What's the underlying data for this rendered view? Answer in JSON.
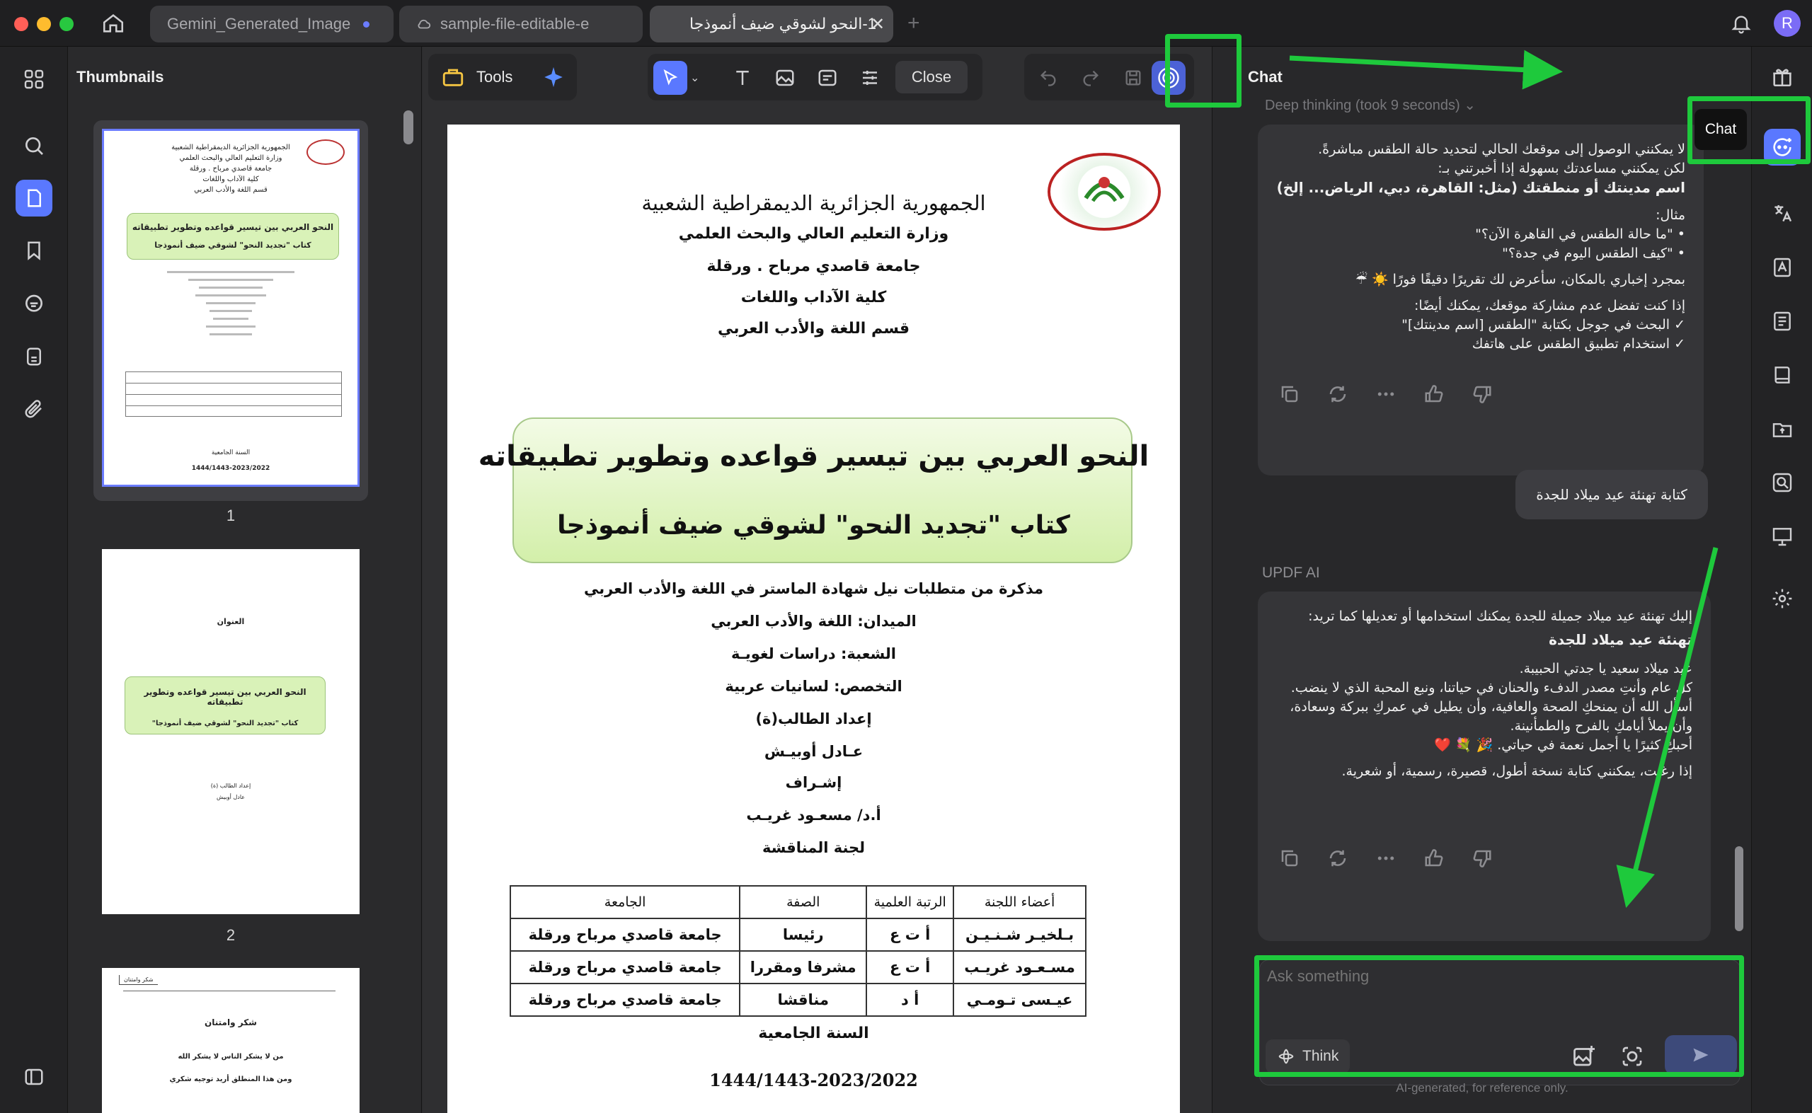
{
  "tabs": [
    {
      "label": "Gemini_Generated_Image",
      "unsaved": true
    },
    {
      "label": "sample-file-editable-e"
    },
    {
      "label": "1-النحو لشوقي ضيف أنموذجا"
    }
  ],
  "avatar_letter": "R",
  "thumbnails": {
    "title": "Thumbnails",
    "pages": [
      {
        "number": "1",
        "lines": [
          "الجمهورية الجزائرية الديمقراطية الشعبية",
          "وزارة التعليم العالي والبحث العلمي",
          "جامعة قاصدي مرباح . ورقلة",
          "كلية الآداب واللغات",
          "قسم اللغة والأدب العربي"
        ],
        "box_title": "النحو العربي بين تيسير قواعده وتطوير تطبيقاته",
        "box_sub": "كتاب \"تجديد النحو\" لشوقي ضيف أنموذجا",
        "year_label": "السنة الجامعية",
        "year": "1444/1443-2023/2022"
      },
      {
        "number": "2",
        "heading": "العنوان",
        "box_title": "النحو العربي بين تيسير قواعده وتطوير تطبيقاته",
        "box_sub": "كتاب \"تجديد النحو\" لشوقي ضيف أنموذجا\"",
        "author_label": "إعداد الطالب (ة)",
        "author": "عادل أوبيش"
      },
      {
        "number": "3",
        "corner": "شكر وامتنان",
        "heading": "شكر وامتنان",
        "line1": "من لا يشكر الناس لا يشكر الله",
        "line2": "ومن هذا المنطلق أريد توجيه شكري"
      }
    ]
  },
  "toolbar": {
    "tools_label": "Tools",
    "close_label": "Close"
  },
  "document": {
    "republic": "الجمهورية الجزائرية الديمقراطية الشعبية",
    "ministry": "وزارة التعليم العالي والبحث العلمي",
    "university": "جامعة قاصدي مرباح . ورقلة",
    "faculty": "كلية الآداب واللغات",
    "department": "قسم اللغة والأدب العربي",
    "title": "النحو العربي بين تيسير قواعده وتطوير تطبيقاته",
    "subtitle": "كتاب \"تجديد النحو\" لشوقي ضيف أنموذجا",
    "memo": "مذكرة من متطلبات نيل شهادة الماستر في اللغة والأدب العربي",
    "field": "الميدان: اللغة والأدب العربي",
    "branch": "الشعبة: دراسات لغويـة",
    "specialty": "التخصص: لسانيات عربية",
    "prepared_by": "إعداد الطالب(ة)",
    "student": "عـادل أوبيـش",
    "supervision": "إشـراف",
    "supervisor": "أ.د/ مسعـود غريـب",
    "committee": "لجنة المناقشة",
    "table": {
      "headers": [
        "أعضاء اللجنة",
        "الرتبة العلمية",
        "الصفة",
        "الجامعة"
      ],
      "rows": [
        [
          "بـلخيـر شـنـيـن",
          "أ ت ع",
          "رئيسا",
          "جامعة قاصدي مرباح ورقلة"
        ],
        [
          "مسـعـود غريـب",
          "أ ت ع",
          "مشرفا ومقررا",
          "جامعة قاصدي مرباح ورقلة"
        ],
        [
          "عيـسى تـومـي",
          "أ د",
          "مناقشا",
          "جامعة قاصدي مرباح ورقلة"
        ]
      ]
    },
    "year_label": "السنة الجامعية",
    "year": "1444/1443-2023/2022"
  },
  "chat": {
    "title": "Chat",
    "deep_thinking": "Deep thinking (took 9 seconds)",
    "msg1": [
      {
        "t": "لا يمكنني الوصول إلى موقعك الحالي لتحديد حالة الطقس مباشرةً.",
        "b": false
      },
      {
        "t": "لكن يمكنني مساعدتك بسهولة إذا أخبرتني بـ:",
        "b": false
      },
      {
        "t": "اسم مدينتك أو منطقتك (مثل: القاهرة، دبي، الرياض... إلخ)",
        "b": true
      },
      {
        "t": "مثال:",
        "b": false
      },
      {
        "t": "• \"ما حالة الطقس في القاهرة الآن؟\"",
        "b": false
      },
      {
        "t": "• \"كيف الطقس اليوم في جدة؟\"",
        "b": false
      },
      {
        "t": "بمجرد إخباري بالمكان، سأعرض لك تقريرًا دقيقًا فورًا ☀️ ☔",
        "b": false
      },
      {
        "t": "إذا كنت تفضل عدم مشاركة موقعك، يمكنك أيضًا:",
        "b": false
      },
      {
        "t": "✓ البحث في جوجل بكتابة \"الطقس [اسم مدينتك]\"",
        "b": false
      },
      {
        "t": "✓ استخدام تطبيق الطقس على هاتفك",
        "b": false
      }
    ],
    "user_msg": "كتابة تهنئة عيد ميلاد للجدة",
    "ai_label": "UPDF AI",
    "msg2": [
      {
        "t": "إليك تهنئة عيد ميلاد جميلة للجدة يمكنك استخدامها أو تعديلها كما تريد:",
        "b": false
      },
      {
        "t": "تهنئة عيد ميلاد للجدة",
        "b": true
      },
      {
        "t": "عيد ميلاد سعيد يا جدتي الحبيبة.",
        "b": false
      },
      {
        "t": "كل عام وأنتِ مصدر الدفء والحنان في حياتنا، ونبع المحبة الذي لا ينضب.",
        "b": false
      },
      {
        "t": "أسأل الله أن يمنحكِ الصحة والعافية، وأن يطيل في عمركِ ببركة وسعادة، وأن يملأ أيامكِ بالفرح والطمأنينة.",
        "b": false
      },
      {
        "t": "أحبكِ كثيرًا يا أجمل نعمة في حياتي. 🎉 💐 ❤️",
        "b": false
      },
      {
        "t": "إذا رغبت، يمكنني كتابة نسخة أطول، قصيرة، رسمية، أو شعرية.",
        "b": false
      }
    ],
    "input_placeholder": "Ask something",
    "think_label": "Think",
    "disclaimer": "AI-generated, for reference only.",
    "tooltip": "Chat"
  },
  "colors": {
    "accent": "#5a78ff",
    "annotation_green": "#1ec93c",
    "title_box_green": "#d9f2b8"
  }
}
